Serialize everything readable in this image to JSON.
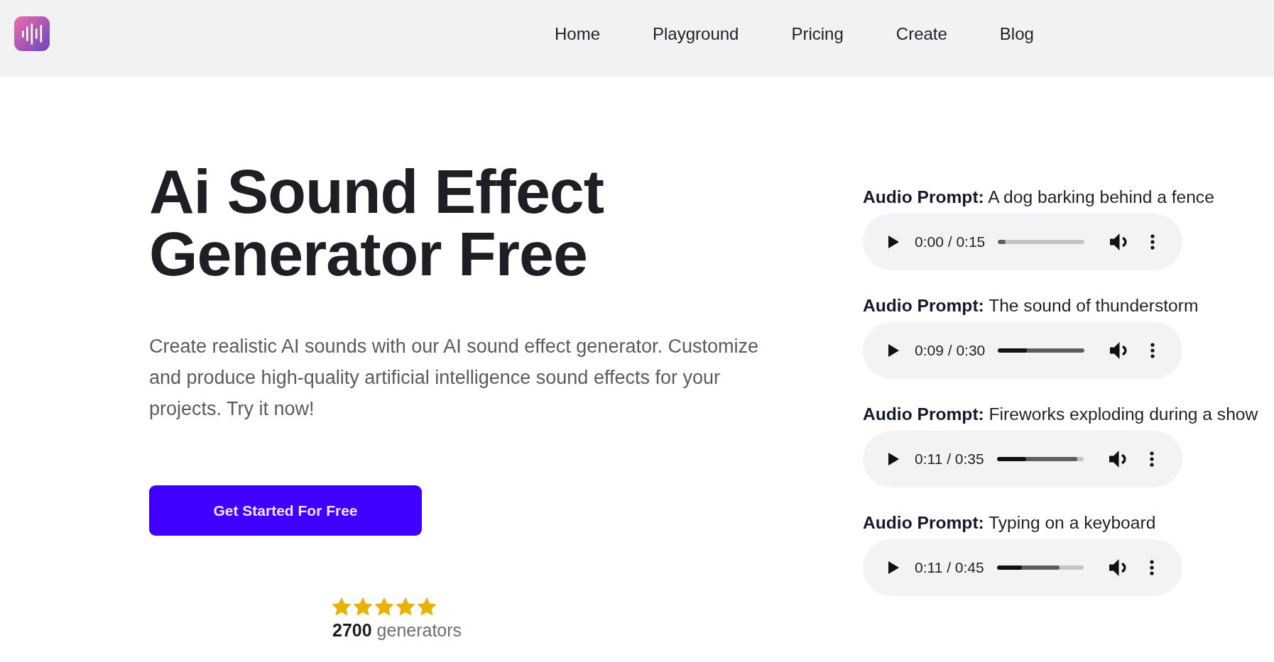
{
  "nav": {
    "links": [
      "Home",
      "Playground",
      "Pricing",
      "Create",
      "Blog"
    ]
  },
  "hero": {
    "title": "Ai Sound Effect Generator Free",
    "description": "Create realistic AI sounds with our AI sound effect generator. Customize and produce high-quality artificial intelligence sound effects for your projects. Try it now!",
    "cta": "Get Started For Free",
    "rating": {
      "stars": 5,
      "text": "**2700** generators"
    }
  },
  "samples": [
    {
      "prompt": "**Audio Prompt:** A dog barking behind a fence",
      "time": "0:00 / 0:15",
      "progress": {
        "level": 0
      },
      "buffer": {
        "level": 0.09
      }
    },
    {
      "prompt": "**Audio Prompt:** The sound of thunderstorm",
      "time": "0:09 / 0:30",
      "progress": {
        "level": 0.33
      },
      "buffer": {
        "level": 1
      }
    },
    {
      "prompt": "**Audio Prompt:** Fireworks exploding during a show",
      "time": "0:11 / 0:35",
      "progress": {
        "level": 0.34
      },
      "buffer": {
        "level": 0.93
      }
    },
    {
      "prompt": "**Audio Prompt:** Typing on a keyboard",
      "time": "0:11 / 0:45",
      "progress": {
        "level": 0.29
      },
      "buffer": {
        "level": 0.72
      }
    }
  ]
}
